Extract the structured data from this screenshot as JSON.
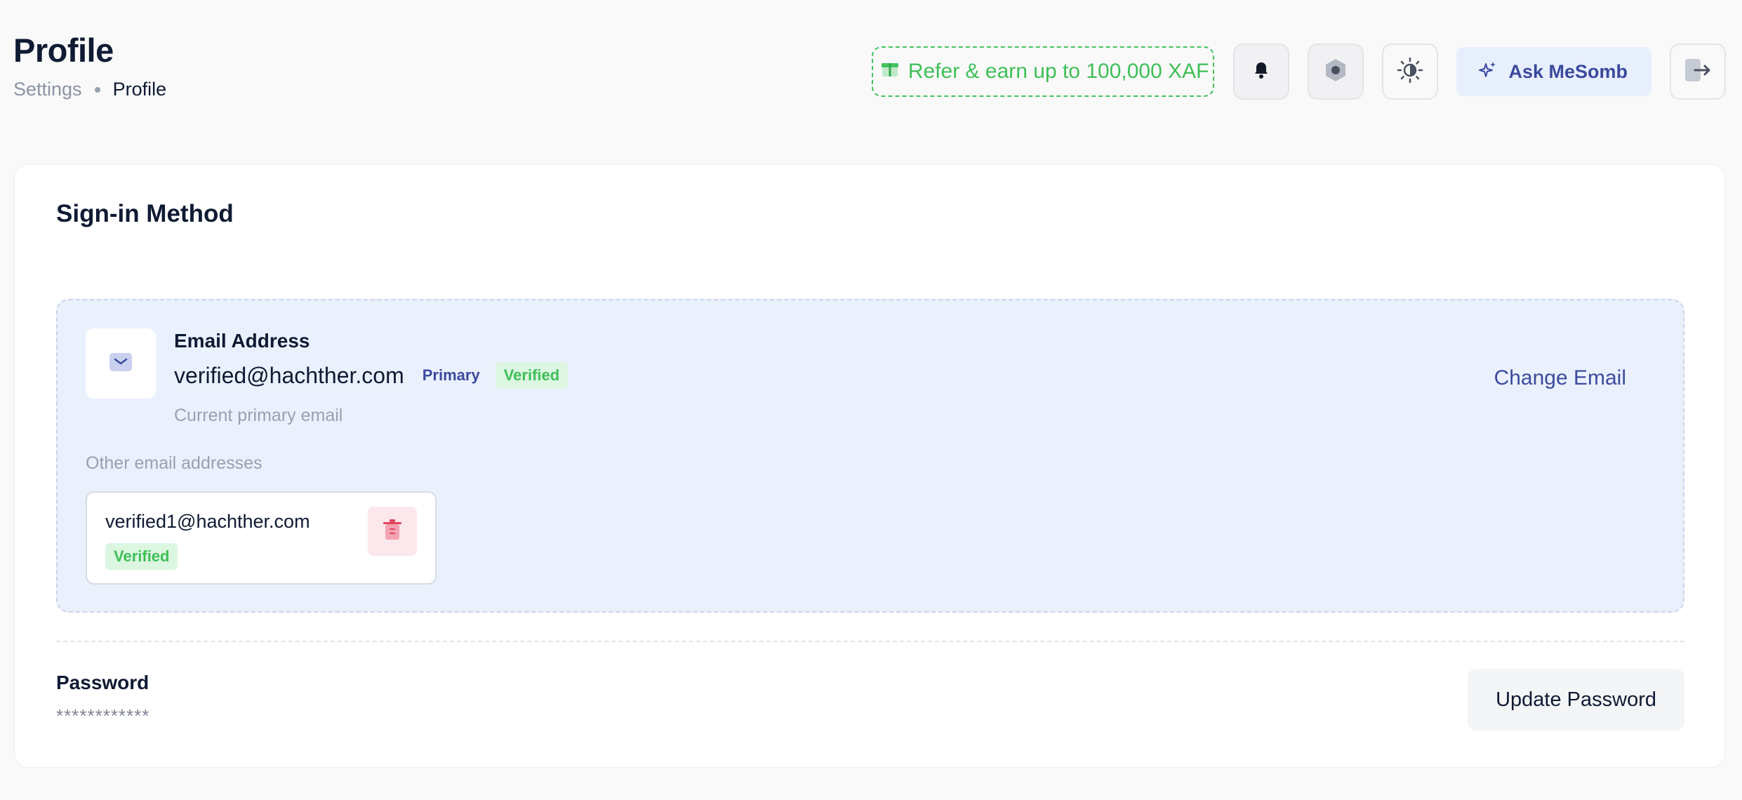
{
  "header": {
    "title": "Profile",
    "breadcrumb": [
      "Settings",
      "Profile"
    ],
    "referral_label": "Refer & earn up to 100,000 XAF",
    "ask_label": "Ask MeSomb"
  },
  "card": {
    "title": "Sign-in Method",
    "email": {
      "heading": "Email Address",
      "primary_email": "verified@hachther.com",
      "primary_badge": "Primary",
      "verified_badge": "Verified",
      "caption": "Current primary email",
      "change_label": "Change Email",
      "other_label": "Other email addresses",
      "others": [
        {
          "email": "verified1@hachther.com",
          "status": "Verified"
        }
      ]
    },
    "password": {
      "label": "Password",
      "mask": "************",
      "update_label": "Update Password"
    }
  },
  "colors": {
    "accent": "#3b4a9c",
    "success": "#3fbf57",
    "panel_bg": "#eaf1fd",
    "danger": "#e0445d"
  },
  "icons": [
    "gift-icon",
    "bell-icon",
    "hexagon-icon",
    "theme-toggle-icon",
    "sparkle-icon",
    "logout-icon",
    "mail-icon",
    "trash-icon"
  ]
}
